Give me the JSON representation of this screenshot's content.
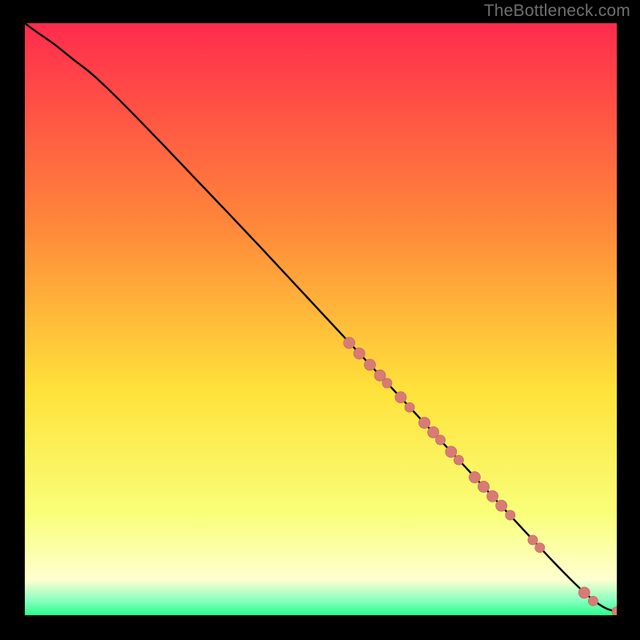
{
  "attribution": "TheBottleneck.com",
  "colors": {
    "gradient_top": "#ff2b4d",
    "gradient_mid1": "#ff8a3a",
    "gradient_mid2": "#ffe23a",
    "gradient_mid3": "#f9ff7a",
    "gradient_mid4": "#ffffd0",
    "gradient_green": "#27ff8a",
    "curve": "#000000",
    "marker_fill": "#d97b75",
    "marker_stroke": "#c26a64"
  },
  "chart_data": {
    "type": "line",
    "title": "",
    "xlabel": "",
    "ylabel": "",
    "xlim": [
      0,
      100
    ],
    "ylim": [
      0,
      100
    ],
    "series": [
      {
        "name": "curve",
        "x": [
          0,
          2,
          5,
          8,
          12,
          20,
          30,
          40,
          50,
          60,
          70,
          80,
          90,
          95,
          98,
          100
        ],
        "y": [
          100,
          98.5,
          96.5,
          94,
          91,
          83,
          72.5,
          62,
          51.2,
          40.5,
          29.8,
          19,
          8.2,
          3.3,
          1.1,
          0.6
        ]
      }
    ],
    "markers": [
      {
        "x": 54.8,
        "y": 46,
        "r": 7
      },
      {
        "x": 56.5,
        "y": 44.2,
        "r": 7
      },
      {
        "x": 58.3,
        "y": 42.3,
        "r": 7
      },
      {
        "x": 60.0,
        "y": 40.5,
        "r": 7
      },
      {
        "x": 61.2,
        "y": 39.2,
        "r": 6
      },
      {
        "x": 63.5,
        "y": 36.8,
        "r": 7
      },
      {
        "x": 65.0,
        "y": 35.1,
        "r": 6
      },
      {
        "x": 67.5,
        "y": 32.5,
        "r": 7
      },
      {
        "x": 69.0,
        "y": 30.9,
        "r": 7
      },
      {
        "x": 70.2,
        "y": 29.6,
        "r": 6
      },
      {
        "x": 72.0,
        "y": 27.6,
        "r": 7
      },
      {
        "x": 73.3,
        "y": 26.2,
        "r": 6
      },
      {
        "x": 76.0,
        "y": 23.3,
        "r": 7
      },
      {
        "x": 77.5,
        "y": 21.7,
        "r": 7
      },
      {
        "x": 79.0,
        "y": 20.1,
        "r": 7
      },
      {
        "x": 80.5,
        "y": 18.5,
        "r": 7
      },
      {
        "x": 82.0,
        "y": 16.9,
        "r": 6
      },
      {
        "x": 85.8,
        "y": 12.7,
        "r": 6
      },
      {
        "x": 87.0,
        "y": 11.4,
        "r": 6
      },
      {
        "x": 94.5,
        "y": 3.8,
        "r": 7
      },
      {
        "x": 96.0,
        "y": 2.4,
        "r": 6
      },
      {
        "x": 100.0,
        "y": 0.6,
        "r": 6
      },
      {
        "x": 101.2,
        "y": 0.6,
        "r": 6
      }
    ]
  }
}
